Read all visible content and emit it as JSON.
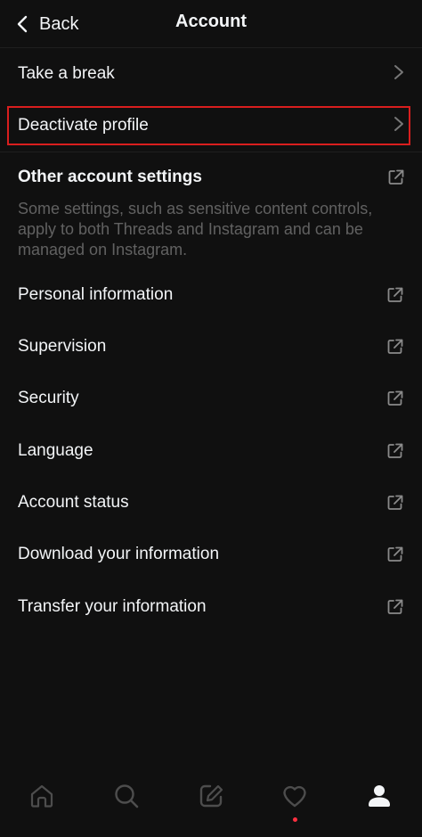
{
  "header": {
    "back_label": "Back",
    "title": "Account"
  },
  "rows_top": [
    {
      "label": "Take a break"
    },
    {
      "label": "Deactivate profile"
    }
  ],
  "other": {
    "title": "Other account settings",
    "description": "Some settings, such as sensitive content controls, apply to both Threads and Instagram and can be managed on Instagram."
  },
  "rows_links": [
    {
      "label": "Personal information"
    },
    {
      "label": "Supervision"
    },
    {
      "label": "Security"
    },
    {
      "label": "Language"
    },
    {
      "label": "Account status"
    },
    {
      "label": "Download your information"
    },
    {
      "label": "Transfer your information"
    }
  ],
  "tabbar": {
    "items": [
      "home-icon",
      "search-icon",
      "compose-icon",
      "heart-icon",
      "profile-icon"
    ],
    "active": "profile-icon",
    "notification_color": "#ff3040"
  },
  "colors": {
    "background": "#101010",
    "highlight": "#d91e1e",
    "muted_text": "#616161"
  }
}
